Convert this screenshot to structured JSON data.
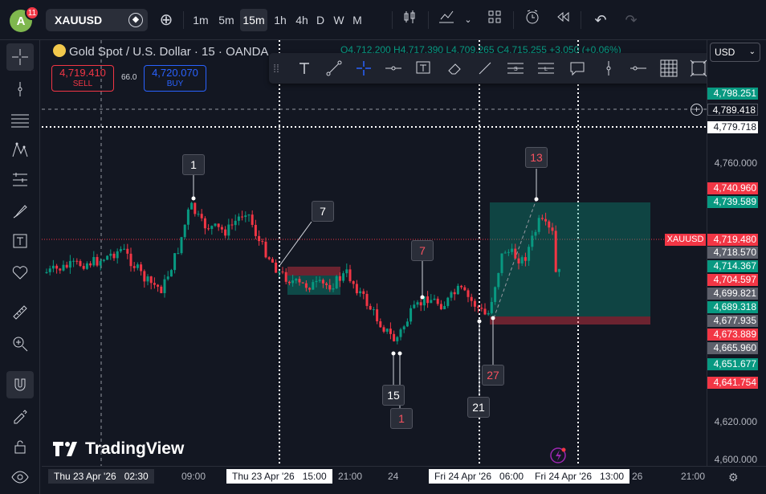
{
  "header": {
    "avatar_letter": "A",
    "avatar_badge": "11",
    "symbol": "XAUUSD",
    "intervals": [
      "1m",
      "5m",
      "15m",
      "1h",
      "4h",
      "D",
      "W",
      "M"
    ],
    "active_interval": "15m"
  },
  "legend": {
    "title": "Gold Spot / U.S. Dollar · 15 · OANDA",
    "ohlc": "O4,712.200 H4,717.390 L4,709.265 C4,715.255 +3.050 (+0.06%)"
  },
  "trade": {
    "sell_price": "4,719.410",
    "sell_label": "SELL",
    "spread": "66.0",
    "buy_price": "4,720.070",
    "buy_label": "BUY"
  },
  "currency": "USD",
  "symbol_tag": "XAUUSD",
  "price_axis": {
    "ticks": [
      "4,760.000",
      "4,620.000",
      "4,600.000"
    ],
    "labels": [
      {
        "text": "4,798.251",
        "color": "#089981"
      },
      {
        "text": "4,789.418",
        "color": "#131722"
      },
      {
        "text": "4,779.718",
        "color": "#ffffff"
      },
      {
        "text": "4,740.960",
        "color": "#f23645"
      },
      {
        "text": "4,739.589",
        "color": "#089981"
      },
      {
        "text": "4,719.480",
        "color": "#f23645"
      },
      {
        "text": "4,718.570",
        "color": "#5d606b"
      },
      {
        "text": "4,714.367",
        "color": "#089981"
      },
      {
        "text": "4,704.597",
        "color": "#f23645"
      },
      {
        "text": "4,699.821",
        "color": "#5d606b"
      },
      {
        "text": "4,689.318",
        "color": "#089981"
      },
      {
        "text": "4,677.935",
        "color": "#5d606b"
      },
      {
        "text": "4,673.889",
        "color": "#f23645"
      },
      {
        "text": "4,665.960",
        "color": "#5d606b"
      },
      {
        "text": "4,651.677",
        "color": "#089981"
      },
      {
        "text": "4,641.754",
        "color": "#f23645"
      }
    ]
  },
  "time_axis": {
    "labels": [
      "Thu 23 Apr '26",
      "02:30",
      "09:00",
      "Thu 23 Apr '26",
      "15:00",
      "21:00",
      "24",
      "Fri 24 Apr '26",
      "06:00",
      "Fri 24 Apr '26",
      "13:00",
      "26",
      "21:00"
    ]
  },
  "annotations": [
    "1",
    "7",
    "7",
    "15",
    "1",
    "21",
    "27",
    "13"
  ],
  "watermark": "TradingView"
}
